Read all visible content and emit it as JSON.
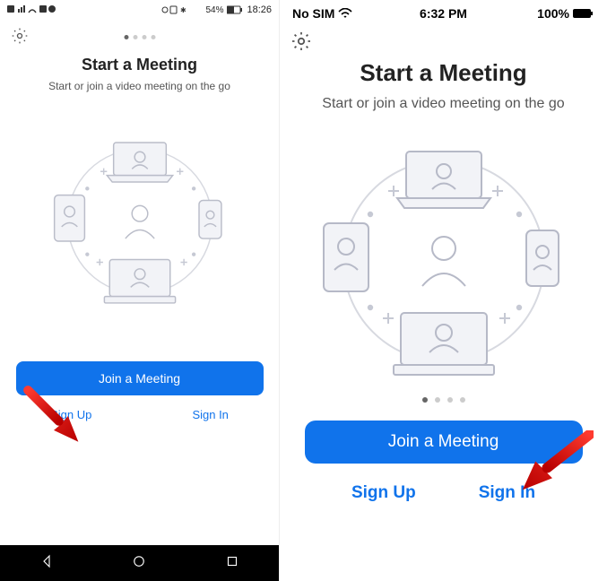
{
  "left": {
    "status": {
      "battery_pct": "54%",
      "time": "18:26"
    },
    "title": "Start a Meeting",
    "subtitle": "Start or join a video meeting on the go",
    "join_label": "Join a Meeting",
    "signup_label": "Sign Up",
    "signin_label": "Sign In"
  },
  "right": {
    "status": {
      "carrier": "No SIM",
      "time": "6:32 PM",
      "battery_pct": "100%"
    },
    "title": "Start a Meeting",
    "subtitle": "Start or join a video meeting on the go",
    "join_label": "Join a Meeting",
    "signup_label": "Sign Up",
    "signin_label": "Sign In"
  }
}
